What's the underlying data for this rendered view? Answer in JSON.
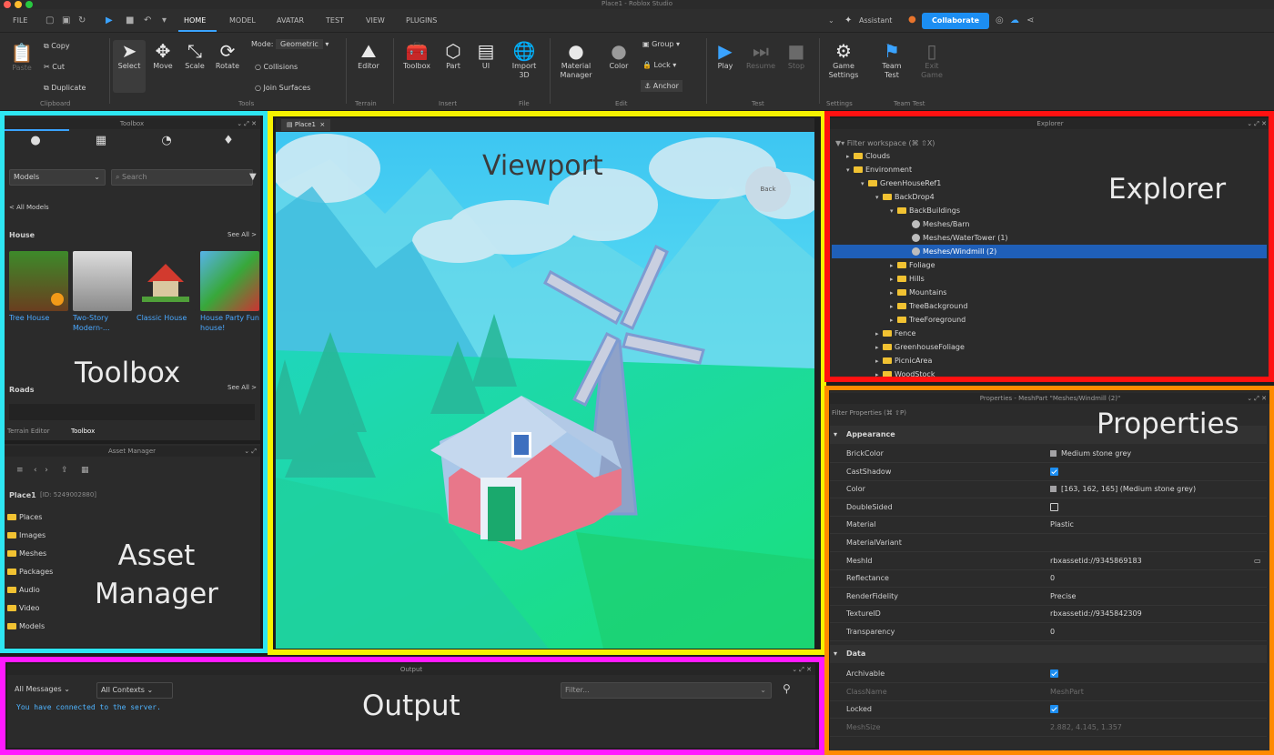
{
  "window": {
    "title": "Place1 - Roblox Studio"
  },
  "menu": {
    "file": "FILE",
    "tabs": [
      "HOME",
      "MODEL",
      "AVATAR",
      "TEST",
      "VIEW",
      "PLUGINS"
    ],
    "assistant": "Assistant",
    "collaborate": "Collaborate"
  },
  "ribbon": {
    "paste": "Paste",
    "copy": "Copy",
    "cut": "Cut",
    "duplicate": "Duplicate",
    "select": "Select",
    "move": "Move",
    "scale": "Scale",
    "rotate": "Rotate",
    "mode_label": "Mode:",
    "mode_value": "Geometric",
    "collisions": "Collisions",
    "join_surfaces": "Join Surfaces",
    "editor": "Editor",
    "toolbox": "Toolbox",
    "part": "Part",
    "ui": "UI",
    "import3d": "Import\n3D",
    "material_manager": "Material\nManager",
    "color": "Color",
    "group": "Group",
    "lock": "Lock",
    "anchor": "Anchor",
    "play": "Play",
    "resume": "Resume",
    "stop": "Stop",
    "game_settings": "Game\nSettings",
    "team_test": "Team\nTest",
    "exit_game": "Exit\nGame",
    "groups": [
      "Clipboard",
      "Tools",
      "Terrain",
      "Insert",
      "File",
      "Edit",
      "Test",
      "Settings",
      "Team Test"
    ]
  },
  "toolbox": {
    "title": "Toolbox",
    "category": "Models",
    "search_placeholder": "Search",
    "breadcrumb": "< All Models",
    "house_header": "House",
    "see_all": "See All >",
    "items": [
      "Tree House",
      "Two-Story Modern-...",
      "Classic House",
      "House Party Fun house!"
    ],
    "roads_header": "Roads",
    "bottom_tabs": [
      "Terrain Editor",
      "Toolbox"
    ],
    "overlay": "Toolbox"
  },
  "asset_manager": {
    "title": "Asset Manager",
    "place": "Place1",
    "place_id": "[ID: 5249002880]",
    "folders": [
      "Places",
      "Images",
      "Meshes",
      "Packages",
      "Audio",
      "Video",
      "Models"
    ],
    "overlay": "Asset\nManager"
  },
  "viewport": {
    "tab": "Place1",
    "overlay": "Viewport",
    "back_label": "Back"
  },
  "explorer": {
    "title": "Explorer",
    "filter": "Filter workspace (⌘ ⇧X)",
    "rows": [
      "Clouds",
      "Environment",
      "GreenHouseRef1",
      "BackDrop4",
      "BackBuildings",
      "Meshes/Barn",
      "Meshes/WaterTower (1)",
      "Meshes/Windmill (2)",
      "Foliage",
      "Hills",
      "Mountains",
      "TreeBackground",
      "TreeForeground",
      "Fence",
      "GreenhouseFoliage",
      "PicnicArea",
      "WoodStock"
    ],
    "overlay": "Explorer"
  },
  "properties": {
    "title": "Properties - MeshPart \"Meshes/Windmill (2)\"",
    "filter": "Filter Properties (⌘ ⇧P)",
    "appearance_header": "Appearance",
    "rows": [
      {
        "name": "BrickColor",
        "value": "Medium stone grey"
      },
      {
        "name": "CastShadow",
        "value": ""
      },
      {
        "name": "Color",
        "value": "[163, 162, 165] (Medium stone grey)"
      },
      {
        "name": "DoubleSided",
        "value": ""
      },
      {
        "name": "Material",
        "value": "Plastic"
      },
      {
        "name": "MaterialVariant",
        "value": ""
      },
      {
        "name": "MeshId",
        "value": "rbxassetid://9345869183"
      },
      {
        "name": "Reflectance",
        "value": "0"
      },
      {
        "name": "RenderFidelity",
        "value": "Precise"
      },
      {
        "name": "TextureID",
        "value": "rbxassetid://9345842309"
      },
      {
        "name": "Transparency",
        "value": "0"
      }
    ],
    "data_header": "Data",
    "data_rows": [
      {
        "name": "Archivable",
        "value": ""
      },
      {
        "name": "ClassName",
        "value": "MeshPart"
      },
      {
        "name": "Locked",
        "value": ""
      },
      {
        "name": "MeshSize",
        "value": "2.882, 4.145, 1.357"
      }
    ],
    "overlay": "Properties"
  },
  "output": {
    "title": "Output",
    "messages_filter": "All Messages",
    "contexts_filter": "All Contexts",
    "filter_placeholder": "Filter...",
    "line": "You have connected to the server.",
    "overlay": "Output"
  },
  "colors": {
    "toolbox_frame": "#2ee6f2",
    "viewport_frame": "#f5f200",
    "explorer_frame": "#ff1111",
    "properties_frame": "#ff8a00",
    "output_frame": "#ff19ff",
    "accent": "#1c8ef2"
  }
}
